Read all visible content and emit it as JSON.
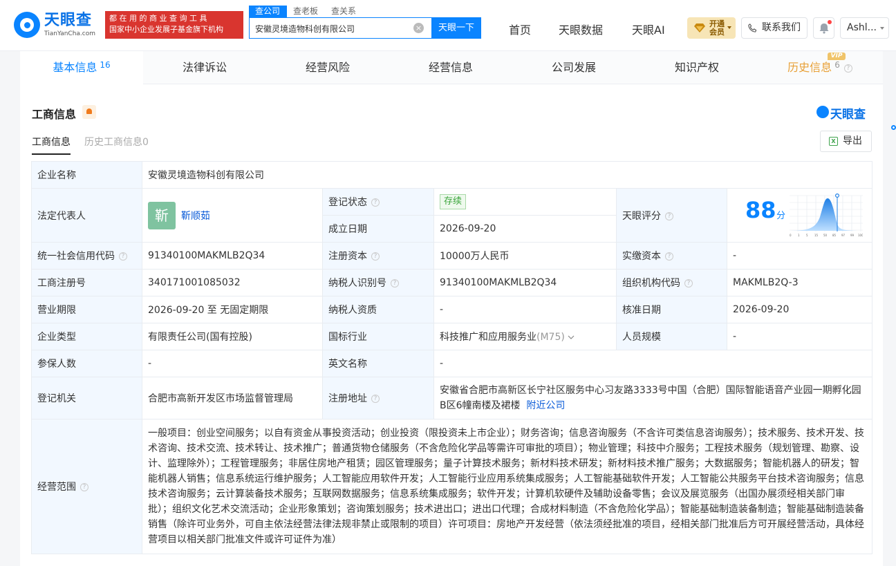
{
  "header": {
    "logo_cn": "天眼查",
    "logo_en": "TianYanCha.com",
    "banner_line1": "都 在 用 的 商 业 查 询 工 具",
    "banner_line2": "国家中小企业发展子基金旗下机构",
    "search_tabs": [
      "查公司",
      "查老板",
      "查关系"
    ],
    "search_value": "安徽灵境造物科创有限公司",
    "search_button": "天眼一下",
    "nav": [
      "首页",
      "天眼数据",
      "天眼AI"
    ],
    "vip_line1": "开通",
    "vip_line2": "会员",
    "contact": "联系我们",
    "user": "Ashl...",
    "icons": [
      "logo-eye-icon",
      "diamond-icon",
      "phone-icon",
      "bell-icon",
      "chevron-down-icon"
    ]
  },
  "tabs": [
    {
      "label": "基本信息",
      "count": "16"
    },
    {
      "label": "法律诉讼",
      "count": ""
    },
    {
      "label": "经营风险",
      "count": ""
    },
    {
      "label": "经营信息",
      "count": ""
    },
    {
      "label": "公司发展",
      "count": ""
    },
    {
      "label": "知识产权",
      "count": ""
    },
    {
      "label": "历史信息",
      "count": "6",
      "tag": "VIP"
    }
  ],
  "section": {
    "title": "工商信息",
    "watermark": "天眼查",
    "subtabs": [
      "工商信息",
      "历史工商信息0"
    ],
    "export": "导出",
    "export_icon": "X"
  },
  "info": {
    "company_name_label": "企业名称",
    "company_name": "安徽灵境造物科创有限公司",
    "legal_rep_label": "法定代表人",
    "legal_rep_avatar": "靳",
    "legal_rep": "靳顺茹",
    "reg_status_label": "登记状态",
    "reg_status": "存续",
    "est_date_label": "成立日期",
    "est_date": "2026-09-20",
    "score_label": "天眼评分",
    "score": "88",
    "score_unit": "分",
    "score_axis": [
      "0",
      "1",
      "5",
      "15",
      "50",
      "85",
      "97",
      "99",
      "100"
    ],
    "credit_code_label": "统一社会信用代码",
    "credit_code": "91340100MAKMLB2Q34",
    "reg_capital_label": "注册资本",
    "reg_capital": "10000万人民币",
    "paid_capital_label": "实缴资本",
    "paid_capital": "-",
    "biz_reg_no_label": "工商注册号",
    "biz_reg_no": "340171001085032",
    "taxpayer_id_label": "纳税人识别号",
    "taxpayer_id": "91340100MAKMLB2Q34",
    "org_code_label": "组织机构代码",
    "org_code": "MAKMLB2Q-3",
    "biz_term_label": "营业期限",
    "biz_term": "2026-09-20 至 无固定期限",
    "taxpayer_qual_label": "纳税人资质",
    "taxpayer_qual": "-",
    "approval_date_label": "核准日期",
    "approval_date": "2026-09-20",
    "company_type_label": "企业类型",
    "company_type": "有限责任公司(国有控股)",
    "industry_label": "国标行业",
    "industry": "科技推广和应用服务业",
    "industry_code": "(M75)",
    "staff_size_label": "人员规模",
    "staff_size": "-",
    "insured_label": "参保人数",
    "insured": "-",
    "english_name_label": "英文名称",
    "english_name": "-",
    "reg_authority_label": "登记机关",
    "reg_authority": "合肥市高新开发区市场监督管理局",
    "reg_address_label": "注册地址",
    "reg_address": "安徽省合肥市高新区长宁社区服务中心习友路3333号中国（合肥）国际智能语音产业园一期孵化园B区6幢南楼及裙楼",
    "nearby_link": "附近公司",
    "scope_label": "经营范围",
    "scope": "一般项目：创业空间服务；以自有资金从事投资活动；创业投资（限投资未上市企业）；财务咨询；信息咨询服务（不含许可类信息咨询服务）；技术服务、技术开发、技术咨询、技术交流、技术转让、技术推广；普通货物仓储服务（不含危险化学品等需许可审批的项目）；物业管理；科技中介服务；工程技术服务（规划管理、勘察、设计、监理除外）；工程管理服务；非居住房地产租赁；园区管理服务；量子计算技术服务；新材料技术研发；新材料技术推广服务；大数据服务；智能机器人的研发；智能机器人销售；信息系统运行维护服务；人工智能应用软件开发；人工智能行业应用系统集成服务；人工智能基础软件开发；人工智能公共服务平台技术咨询服务；信息技术咨询服务；云计算装备技术服务；互联网数据服务；信息系统集成服务；软件开发；计算机软硬件及辅助设备零售；会议及展览服务（出国办展须经相关部门审批）；组织文化艺术交流活动；企业形象策划；咨询策划服务；技术进出口；进出口代理；合成材料制造（不含危险化学品）；智能基础制造装备制造；智能基础制造装备销售（除许可业务外，可自主依法经营法律法规非禁止或限制的项目）许可项目：房地产开发经营（依法须经批准的项目，经相关部门批准后方可开展经营活动，具体经营项目以相关部门批准文件或许可证件为准）"
  },
  "colors": {
    "primary": "#0a84ff",
    "banner_red": "#d9352f",
    "label_bg": "#f2f8ff",
    "status_green": "#3aa53a",
    "vip_gold": "#f7e5b6"
  }
}
